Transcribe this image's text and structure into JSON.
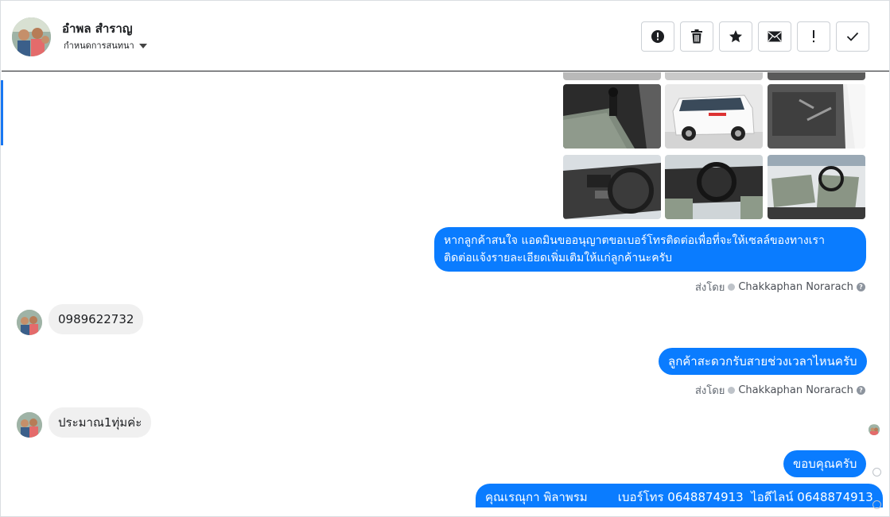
{
  "header": {
    "contact_name": "อำพล สำราญ",
    "conversation_settings": "กำหนดการสนทนา",
    "toolbar": [
      {
        "icon": "alert-circle-icon",
        "name": "mark-spam-button"
      },
      {
        "icon": "trash-icon",
        "name": "delete-button"
      },
      {
        "icon": "star-icon",
        "name": "star-button"
      },
      {
        "icon": "envelope-icon",
        "name": "mark-unread-button"
      },
      {
        "icon": "exclamation-icon",
        "name": "follow-up-button"
      },
      {
        "icon": "checkmark-icon",
        "name": "mark-done-button"
      }
    ]
  },
  "messages": {
    "out1": "หากลูกค้าสนใจ แอดมินขออนุญาตขอเบอร์โทรติดต่อเพื่อที่จะให้เซลล์ของทางเราติดต่อแจ้งรายละเอียดเพิ่มเติมให้แก่ลูกค้านะครับ",
    "out1_line1": "หากลูกค้าสนใจ แอดมินขออนุญาตขอเบอร์โทรติดต่อเพื่อที่จะให้เซลล์ของทางเรา",
    "out1_line2": "ติดต่อแจ้งรายละเอียดเพิ่มเติมให้แก่ลูกค้านะครับ",
    "sent_by_label": "ส่งโดย",
    "sender_name": "Chakkaphan Norarach",
    "in1": "0989622732",
    "out2": "ลูกค้าสะดวกรับสายช่วงเวลาไหนครับ",
    "in2": "ประมาณ1ทุ่มค่ะ",
    "out3": "ขอบคุณครับ",
    "out4": "คุณเรณุกา พิลาพรม        เบอร์โทร 0648874913  ไอดีไลน์ 0648874913"
  },
  "colors": {
    "outgoing_bubble": "#0a7cff",
    "incoming_bubble": "#f0f0f0",
    "accent": "#1877f2"
  }
}
